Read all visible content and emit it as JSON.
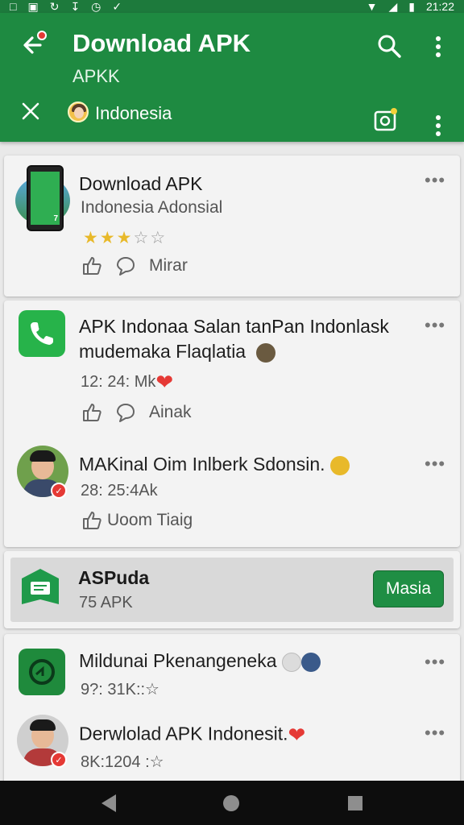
{
  "status_bar": {
    "time": "21:22",
    "left_icons": [
      "notification-icon",
      "image-icon",
      "sync-icon",
      "download-icon",
      "clock-icon",
      "check-icon"
    ],
    "right_icons": [
      "wifi-icon",
      "signal-icon",
      "battery-icon"
    ]
  },
  "app_bar": {
    "title": "Download APK",
    "subtitle": "APKK",
    "country": "Indonesia"
  },
  "cards": {
    "c1": {
      "title": "Download APK",
      "subtitle": "Indonesia Adonsial",
      "rating_filled": 3,
      "rating_total": 5,
      "action_label": "Mirar",
      "phone_label": "7"
    },
    "c2": {
      "title_line1": "APK Indonaa Salan tanPan Indonlask",
      "title_line2": "mudemaka Flaqlatia",
      "meta": "12: 24: Mk",
      "action_label": "Ainak",
      "person_title": "MAKinal Oim Inlberk Sdonsin.",
      "person_meta": "28: 25:4Ak",
      "person_action": "Uoom Tiaig"
    },
    "c3": {
      "title": "ASPuda",
      "subtitle": "75 APK",
      "button": "Masia"
    },
    "c4": {
      "title": "Mildunai Pkenangeneka",
      "meta": "9?: 31K::☆",
      "person_title": "Derwlolad APK Indonesit.",
      "person_meta": "8K:1204 :☆"
    }
  },
  "colors": {
    "app_bar": "#1e8a41",
    "accent_green": "#1f8e44",
    "heart_red": "#e53935",
    "star_gold": "#e8b92a"
  }
}
